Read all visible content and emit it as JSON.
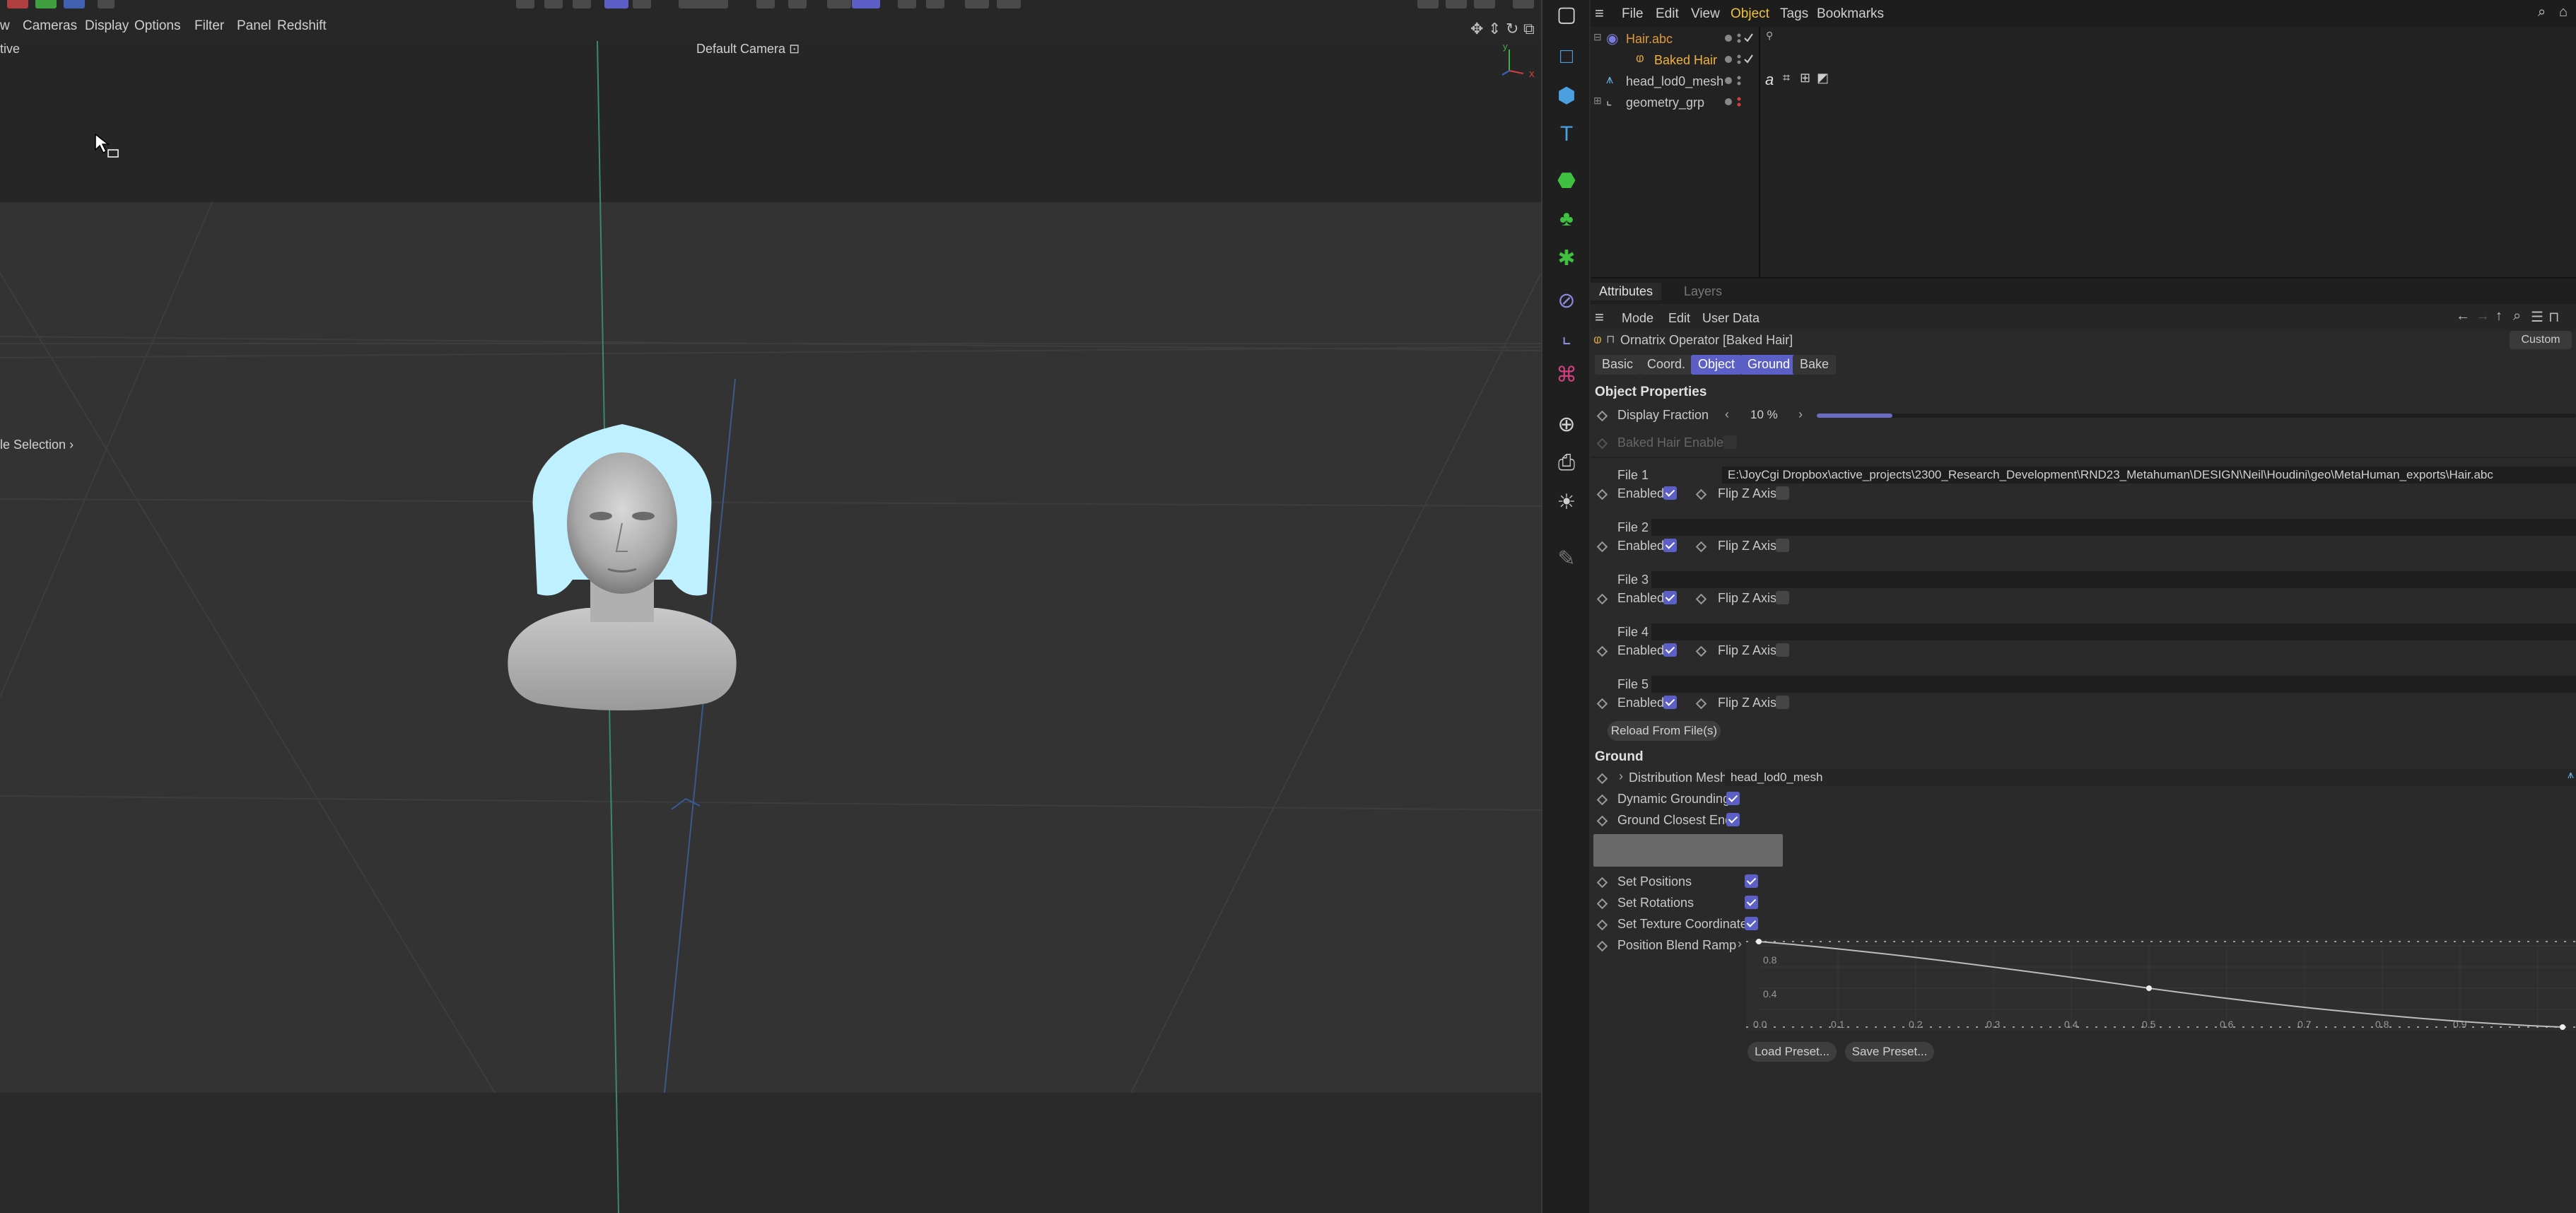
{
  "viewport": {
    "menu": [
      "w",
      "Cameras",
      "Display",
      "Options",
      "Filter",
      "Panel",
      "Redshift"
    ],
    "camera_title": "Default Camera",
    "persp_label": "tive",
    "selection_label": "le Selection",
    "axis_x": "x",
    "axis_y": "y"
  },
  "object_manager": {
    "menu": [
      "File",
      "Edit",
      "View",
      "Object",
      "Tags",
      "Bookmarks"
    ],
    "active_menu": "Object",
    "tree": [
      {
        "name": "Hair.abc",
        "color": "#e09a3a"
      },
      {
        "name": "Baked Hair",
        "color": "#f0b040"
      },
      {
        "name": "head_lod0_mesh",
        "color": "#c8c8c8"
      },
      {
        "name": "geometry_grp",
        "color": "#c8c8c8"
      }
    ]
  },
  "attributes": {
    "tabs": [
      "Attributes",
      "Layers"
    ],
    "menu": [
      "Mode",
      "Edit",
      "User Data"
    ],
    "preset": "Custom",
    "operator_title": "Ornatrix Operator [Baked Hair]",
    "subtabs": [
      "Basic",
      "Coord.",
      "Object",
      "Ground",
      "Bake"
    ],
    "active_subtabs": [
      "Object",
      "Ground"
    ],
    "object_properties": "Object Properties",
    "display_fraction_label": "Display Fraction",
    "display_fraction_value": "10 %",
    "display_fraction": 0.1,
    "baked_hair_enabled": "Baked Hair Enabled",
    "files": [
      {
        "label": "File 1",
        "path": "E:\\JoyCgi Dropbox\\active_projects\\2300_Research_Development\\RND23_Metahuman\\DESIGN\\Neil\\Houdini\\geo\\MetaHuman_exports\\Hair.abc"
      },
      {
        "label": "File 2",
        "path": ""
      },
      {
        "label": "File 3",
        "path": ""
      },
      {
        "label": "File 4",
        "path": ""
      },
      {
        "label": "File 5",
        "path": ""
      }
    ],
    "enabled_label": "Enabled",
    "flip_z_label": "Flip Z Axis",
    "reload_button": "Reload From File(s)",
    "ground_title": "Ground",
    "distribution_mesh_label": "Distribution Mesh",
    "distribution_mesh_value": "head_lod0_mesh",
    "dynamic_grounding": "Dynamic Grounding",
    "ground_closest_end": "Ground Closest End",
    "set_positions": "Set Positions",
    "set_rotations": "Set Rotations",
    "set_texture_coords": "Set Texture Coordinates",
    "position_blend_ramp": "Position Blend Ramp",
    "ramp_y_ticks": [
      "0.8",
      "0.4"
    ],
    "ramp_x_ticks": [
      "0.0",
      "0.1",
      "0.2",
      "0.3",
      "0.4",
      "0.5",
      "0.6",
      "0.7",
      "0.8",
      "0.9"
    ],
    "load_preset": "Load Preset...",
    "save_preset": "Save Preset..."
  },
  "colors": {
    "accent": "#5b5fc6",
    "hair": "#bff0ff",
    "active_menu": "#f0c040"
  }
}
